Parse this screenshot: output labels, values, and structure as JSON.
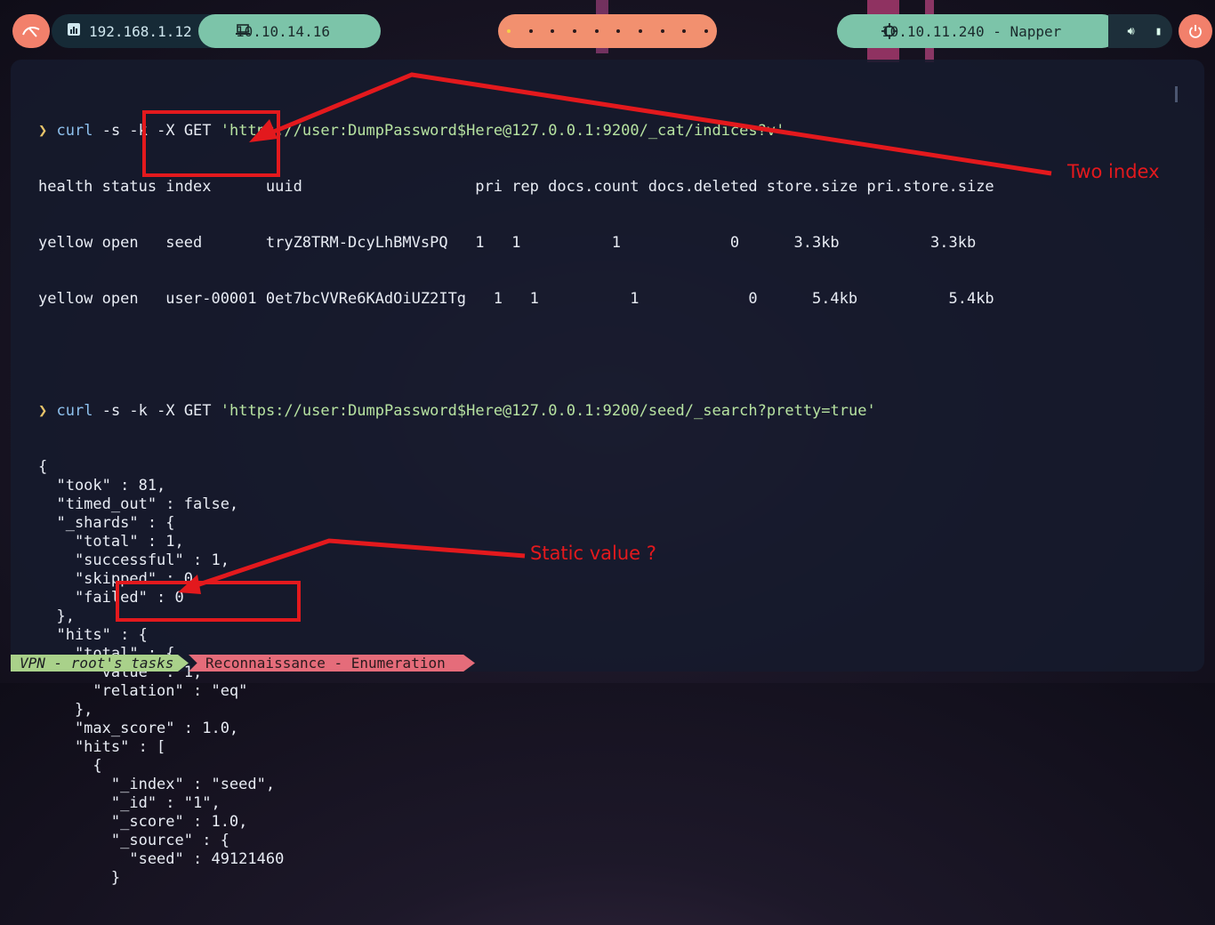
{
  "topbar": {
    "host_ip": "192.168.1.12",
    "vpn_ip": "10.10.14.16",
    "target": "10.10.11.240 - Napper",
    "workspaces": [
      true,
      false,
      false,
      false,
      false,
      false,
      false,
      false,
      false,
      false
    ]
  },
  "terminal": {
    "command1": {
      "prompt": "❯",
      "curl": "curl",
      "args": "-s -k -X GET",
      "url": "'https://user:DumpPassword$Here@127.0.0.1:9200/_cat/indices?v'"
    },
    "table": [
      "health status index      uuid                   pri rep docs.count docs.deleted store.size pri.store.size",
      "yellow open   seed       tryZ8TRM-DcyLhBMVsPQ   1   1          1            0      3.3kb          3.3kb",
      "yellow open   user-00001 0et7bcVVRe6KAdOiUZ2ITg   1   1          1            0      5.4kb          5.4kb"
    ],
    "command2": {
      "prompt": "❯",
      "curl": "curl",
      "args": "-s -k -X GET",
      "url": "'https://user:DumpPassword$Here@127.0.0.1:9200/seed/_search?pretty=true'"
    },
    "json_output": [
      "{",
      "  \"took\" : 81,",
      "  \"timed_out\" : false,",
      "  \"_shards\" : {",
      "    \"total\" : 1,",
      "    \"successful\" : 1,",
      "    \"skipped\" : 0,",
      "    \"failed\" : 0",
      "  },",
      "  \"hits\" : {",
      "    \"total\" : {",
      "      \"value\" : 1,",
      "      \"relation\" : \"eq\"",
      "    },",
      "    \"max_score\" : 1.0,",
      "    \"hits\" : [",
      "      {",
      "        \"_index\" : \"seed\",",
      "        \"_id\" : \"1\",",
      "        \"_score\" : 1.0,",
      "        \"_source\" : {",
      "          \"seed\" : 49121460",
      "        }"
    ]
  },
  "statusbar": {
    "session": "VPN - root's tasks",
    "window": "Reconnaissance - Enumeration"
  },
  "annotations": {
    "two_index": "Two index",
    "static_value": "Static value ?",
    "color": "#e3191d"
  }
}
